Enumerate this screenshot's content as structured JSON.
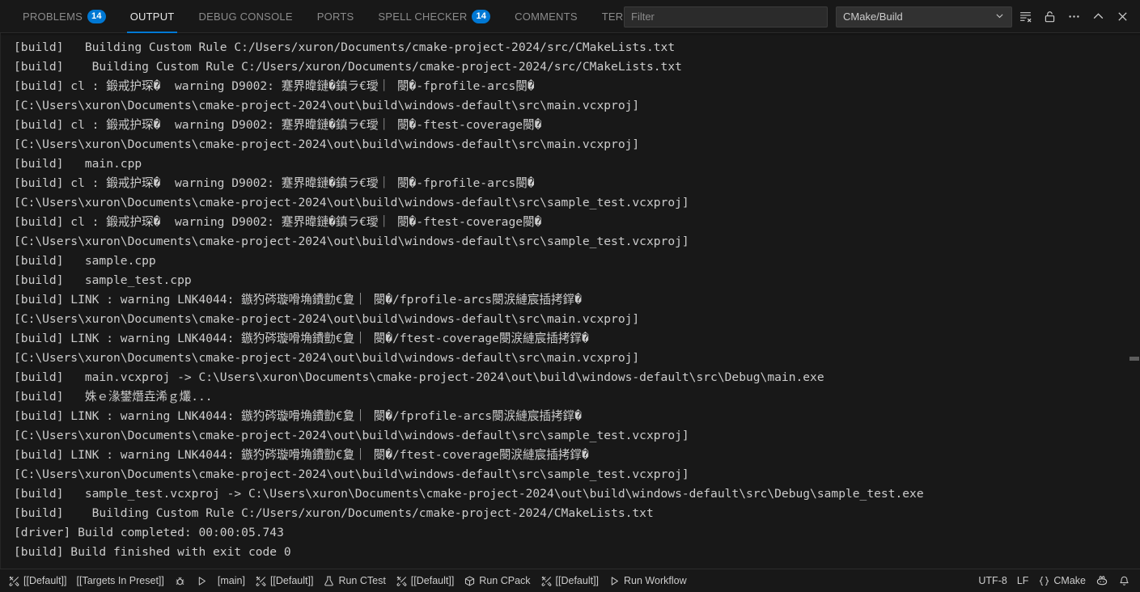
{
  "panel": {
    "tabs": [
      {
        "label": "PROBLEMS",
        "badge": "14",
        "active": false,
        "name": "tab-problems"
      },
      {
        "label": "OUTPUT",
        "badge": "",
        "active": true,
        "name": "tab-output"
      },
      {
        "label": "DEBUG CONSOLE",
        "badge": "",
        "active": false,
        "name": "tab-debug-console"
      },
      {
        "label": "PORTS",
        "badge": "",
        "active": false,
        "name": "tab-ports"
      },
      {
        "label": "SPELL CHECKER",
        "badge": "14",
        "active": false,
        "name": "tab-spell-checker"
      },
      {
        "label": "COMMENTS",
        "badge": "",
        "active": false,
        "name": "tab-comments"
      },
      {
        "label": "TERMINAL",
        "badge": "",
        "active": false,
        "name": "tab-terminal"
      }
    ],
    "filter": {
      "value": "",
      "placeholder": "Filter"
    },
    "channel": {
      "selected": "CMake/Build"
    },
    "actions": [
      {
        "name": "clear-output-icon",
        "title": "Clear Output"
      },
      {
        "name": "unlock-scroll-icon",
        "title": "Turn Auto Scrolling Off"
      },
      {
        "name": "more-actions-icon",
        "title": "Views and More Actions..."
      },
      {
        "name": "maximize-panel-icon",
        "title": "Maximize Panel Size"
      },
      {
        "name": "close-panel-icon",
        "title": "Close Panel"
      }
    ]
  },
  "output": {
    "lines": [
      "[build]   Building Custom Rule C:/Users/xuron/Documents/cmake-project-2024/src/CMakeLists.txt",
      "[build]    Building Custom Rule C:/Users/xuron/Documents/cmake-project-2024/src/CMakeLists.txt",
      "[build] cl : 鍛戒护琛�  warning D9002: 蹇界暐鏈�鎮ラ€璦｜ 閿�-fprofile-arcs閿�",
      "[C:\\Users\\xuron\\Documents\\cmake-project-2024\\out\\build\\windows-default\\src\\main.vcxproj]",
      "[build] cl : 鍛戒护琛�  warning D9002: 蹇界暐鏈�鎮ラ€璦｜ 閿�-ftest-coverage閿�",
      "[C:\\Users\\xuron\\Documents\\cmake-project-2024\\out\\build\\windows-default\\src\\main.vcxproj]",
      "[build]   main.cpp",
      "[build] cl : 鍛戒护琛�  warning D9002: 蹇界暐鏈�鎮ラ€璦｜ 閿�-fprofile-arcs閿�",
      "[C:\\Users\\xuron\\Documents\\cmake-project-2024\\out\\build\\windows-default\\src\\sample_test.vcxproj]",
      "[build] cl : 鍛戒护琛�  warning D9002: 蹇界暐鏈�鎮ラ€璦｜ 閿�-ftest-coverage閿�",
      "[C:\\Users\\xuron\\Documents\\cmake-project-2024\\out\\build\\windows-default\\src\\sample_test.vcxproj]",
      "[build]   sample.cpp",
      "[build]   sample_test.cpp",
      "[build] LINK : warning LNK4044: 鏃犳硶璇嗗埆鐨勯€夐｜ 閿�/fprofile-arcs閿涙縺宸插拷鐣�",
      "[C:\\Users\\xuron\\Documents\\cmake-project-2024\\out\\build\\windows-default\\src\\main.vcxproj]",
      "[build] LINK : warning LNK4044: 鏃犳硶璇嗗埆鐨勯€夐｜ 閿�/ftest-coverage閿涙縺宸插拷鐣�",
      "[C:\\Users\\xuron\\Documents\\cmake-project-2024\\out\\build\\windows-default\\src\\main.vcxproj]",
      "[build]   main.vcxproj -> C:\\Users\\xuron\\Documents\\cmake-project-2024\\out\\build\\windows-default\\src\\Debug\\main.exe",
      "[build]   姝ｅ湪鐢熸垚浠ｇ爜...",
      "[build] LINK : warning LNK4044: 鏃犳硶璇嗗埆鐨勯€夐｜ 閿�/fprofile-arcs閿涙縺宸插拷鐣�",
      "[C:\\Users\\xuron\\Documents\\cmake-project-2024\\out\\build\\windows-default\\src\\sample_test.vcxproj]",
      "[build] LINK : warning LNK4044: 鏃犳硶璇嗗埆鐨勯€夐｜ 閿�/ftest-coverage閿涙縺宸插拷鐣�",
      "[C:\\Users\\xuron\\Documents\\cmake-project-2024\\out\\build\\windows-default\\src\\sample_test.vcxproj]",
      "[build]   sample_test.vcxproj -> C:\\Users\\xuron\\Documents\\cmake-project-2024\\out\\build\\windows-default\\src\\Debug\\sample_test.exe",
      "[build]    Building Custom Rule C:/Users/xuron/Documents/cmake-project-2024/CMakeLists.txt",
      "[driver] Build completed: 00:00:05.743",
      "[build] Build finished with exit code 0"
    ]
  },
  "statusbar": {
    "left": [
      {
        "icon": "tools-icon",
        "label": "[[Default]]",
        "name": "status-kit-selector"
      },
      {
        "icon": "",
        "label": "[[Targets In Preset]]",
        "name": "status-build-target"
      },
      {
        "icon": "bug-icon",
        "label": "",
        "name": "status-debug-button"
      },
      {
        "icon": "play-icon",
        "label": "",
        "name": "status-launch-button"
      },
      {
        "icon": "",
        "label": "[main]",
        "name": "status-launch-target"
      },
      {
        "icon": "tools-icon",
        "label": "[[Default]]",
        "name": "status-test-preset"
      },
      {
        "icon": "beaker-icon",
        "label": "Run CTest",
        "name": "status-run-ctest"
      },
      {
        "icon": "tools-icon",
        "label": "[[Default]]",
        "name": "status-package-preset"
      },
      {
        "icon": "package-icon",
        "label": "Run CPack",
        "name": "status-run-cpack"
      },
      {
        "icon": "tools-icon",
        "label": "[[Default]]",
        "name": "status-workflow-preset"
      },
      {
        "icon": "play-icon",
        "label": "Run Workflow",
        "name": "status-run-workflow"
      }
    ],
    "right": [
      {
        "icon": "",
        "label": "UTF-8",
        "name": "status-encoding"
      },
      {
        "icon": "",
        "label": "LF",
        "name": "status-eol"
      },
      {
        "icon": "braces-icon",
        "label": "CMake",
        "name": "status-language-mode"
      },
      {
        "icon": "copilot-icon",
        "label": "",
        "name": "status-copilot"
      },
      {
        "icon": "bell-icon",
        "label": "",
        "name": "status-notifications"
      }
    ]
  },
  "colors": {
    "accent": "#0078d4",
    "background": "#181818",
    "text": "#cccccc",
    "muted": "#8b8b8b"
  }
}
